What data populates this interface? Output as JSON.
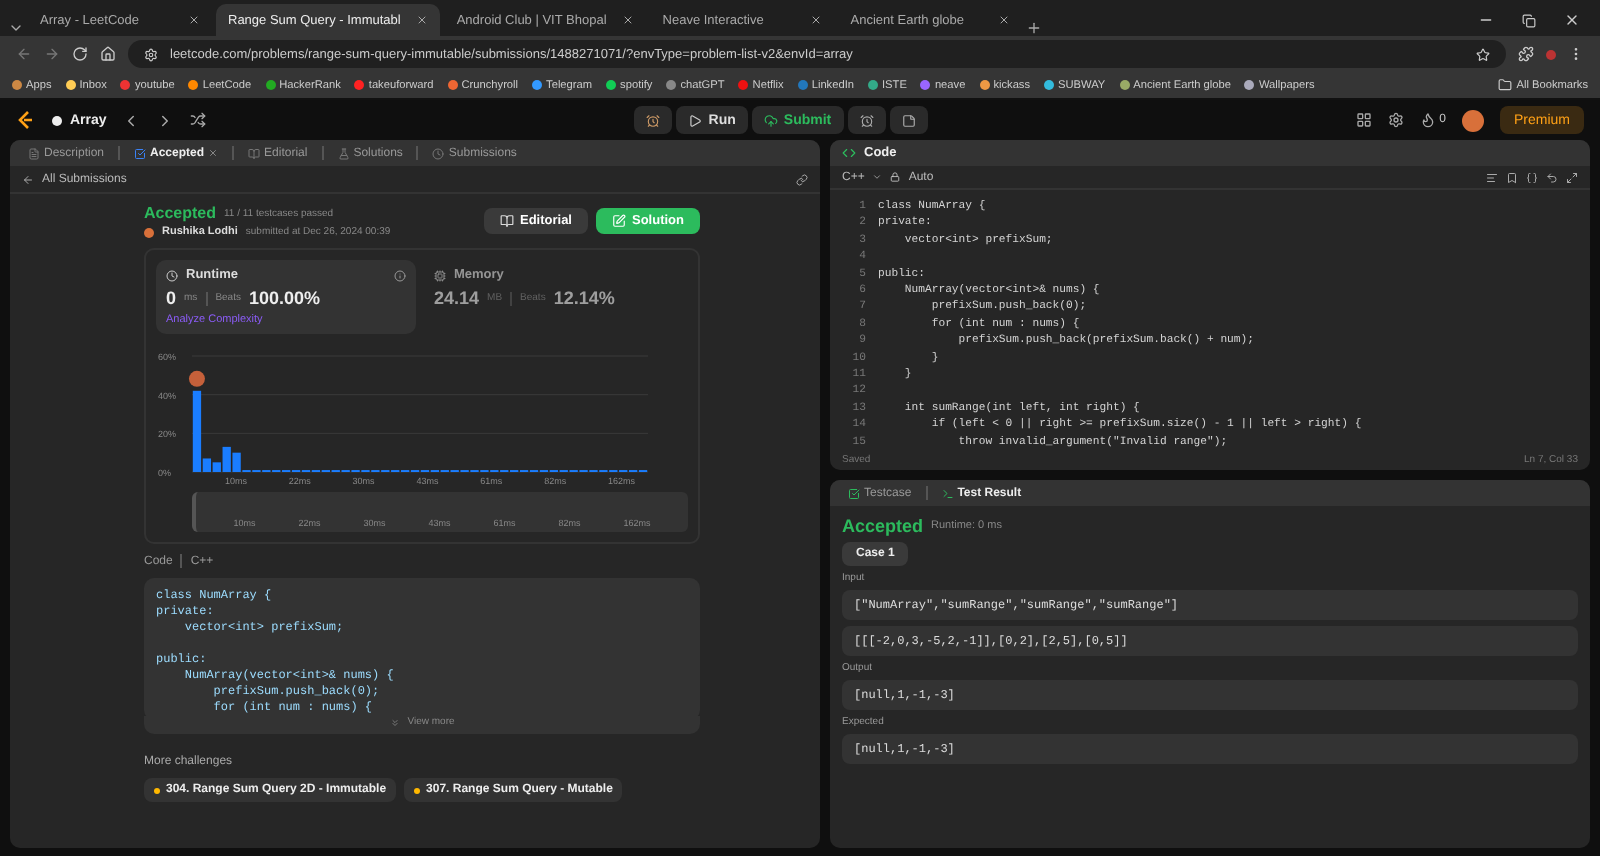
{
  "browser": {
    "tabs": [
      {
        "title": "Array - LeetCode",
        "selected": false
      },
      {
        "title": "Range Sum Query - Immutabl",
        "selected": true
      },
      {
        "title": "Android Club | VIT Bhopal",
        "selected": false
      },
      {
        "title": "Neave Interactive",
        "selected": false
      },
      {
        "title": "Ancient Earth globe",
        "selected": false
      }
    ],
    "url": "leetcode.com/problems/range-sum-query-immutable/submissions/1488271071/?envType=problem-list-v2&envId=array",
    "bookmarks": [
      "Apps",
      "Inbox",
      "youtube",
      "LeetCode",
      "HackerRank",
      "takeuforward",
      "Crunchyroll",
      "Telegram",
      "spotify",
      "chatGPT",
      "Netflix",
      "LinkedIn",
      "ISTE",
      "neave",
      "kickass",
      "SUBWAY",
      "Ancient Earth globe",
      "Wallpapers"
    ],
    "all_bookmarks": "All Bookmarks"
  },
  "topbar": {
    "problem_list": "Array",
    "run": "Run",
    "submit": "Submit",
    "streak": "0",
    "premium": "Premium"
  },
  "left": {
    "tabs": [
      {
        "label": "Description",
        "selected": false
      },
      {
        "label": "Accepted",
        "selected": true
      },
      {
        "label": "Editorial",
        "selected": false
      },
      {
        "label": "Solutions",
        "selected": false
      },
      {
        "label": "Submissions",
        "selected": false
      }
    ],
    "back": "All Submissions",
    "status": "Accepted",
    "passed": "11 / 11 testcases passed",
    "author": "Rushika Lodhi",
    "submitted": "submitted at Dec 26, 2024 00:39",
    "editorial": "Editorial",
    "solution": "Solution",
    "stats": [
      {
        "label": "Runtime",
        "value": "0",
        "unit": "ms",
        "beats_label": "Beats",
        "beats": "100.00%",
        "selected": true
      },
      {
        "label": "Memory",
        "value": "24.14",
        "unit": "MB",
        "beats_label": "Beats",
        "beats": "12.14%",
        "selected": false
      }
    ],
    "analyze": "Analyze Complexity",
    "chart_data": {
      "type": "bar",
      "ylim": [
        0,
        60
      ],
      "yticks": [
        {
          "value": 0,
          "label": "0%"
        },
        {
          "value": 20,
          "label": "20%"
        },
        {
          "value": 40,
          "label": "40%"
        },
        {
          "value": 60,
          "label": "60%"
        }
      ],
      "values": [
        42,
        7,
        5,
        13,
        10,
        1,
        1,
        1,
        1,
        1,
        1,
        1,
        1,
        1,
        1,
        1,
        1,
        1,
        1,
        1,
        1,
        1,
        1,
        1,
        1,
        1,
        1,
        1,
        1,
        1,
        1,
        1,
        1,
        1,
        1,
        1,
        1,
        1,
        1,
        1,
        1,
        1,
        1,
        1,
        1,
        1
      ]
    },
    "axis_labels": [
      "10ms",
      "22ms",
      "30ms",
      "43ms",
      "61ms",
      "82ms",
      "162ms"
    ],
    "overview_labels": [
      "10ms",
      "22ms",
      "30ms",
      "43ms",
      "61ms",
      "82ms",
      "162ms"
    ],
    "code_label": "Code",
    "code_lang": "C++",
    "code": "class NumArray {\nprivate:\n    vector<int> prefixSum;\n\npublic:\n    NumArray(vector<int>& nums) {\n        prefixSum.push_back(0);\n        for (int num : nums) {",
    "view_more": "View more",
    "more_title": "More challenges",
    "challenges": [
      "304. Range Sum Query 2D - Immutable",
      "307. Range Sum Query - Mutable"
    ]
  },
  "editor": {
    "title": "Code",
    "lang": "C++",
    "mode": "Auto",
    "line_numbers": [
      "1",
      "2",
      "3",
      "4",
      "5",
      "6",
      "7",
      "8",
      "9",
      "10",
      "11",
      "12",
      "13",
      "14",
      "15"
    ],
    "code": "class NumArray {\nprivate:\n    vector<int> prefixSum;\n\npublic:\n    NumArray(vector<int>& nums) {\n        prefixSum.push_back(0);\n        for (int num : nums) {\n            prefixSum.push_back(prefixSum.back() + num);\n        }\n    }\n\n    int sumRange(int left, int right) {\n        if (left < 0 || right >= prefixSum.size() - 1 || left > right) {\n            throw invalid_argument(\"Invalid range\");",
    "saved": "Saved",
    "cursor": "Ln 7, Col 33"
  },
  "results": {
    "tabs": [
      {
        "label": "Testcase",
        "selected": false
      },
      {
        "label": "Test Result",
        "selected": true
      }
    ],
    "status": "Accepted",
    "runtime": "Runtime: 0 ms",
    "cases": [
      {
        "label": "Case 1",
        "selected": true
      }
    ],
    "sections": [
      {
        "label": "Input",
        "values": [
          "[\"NumArray\",\"sumRange\",\"sumRange\",\"sumRange\"]",
          "[[[-2,0,3,-5,2,-1]],[0,2],[2,5],[0,5]]"
        ]
      },
      {
        "label": "Output",
        "values": [
          "[null,1,-1,-3]"
        ]
      },
      {
        "label": "Expected",
        "values": [
          "[null,1,-1,-3]"
        ]
      }
    ]
  }
}
